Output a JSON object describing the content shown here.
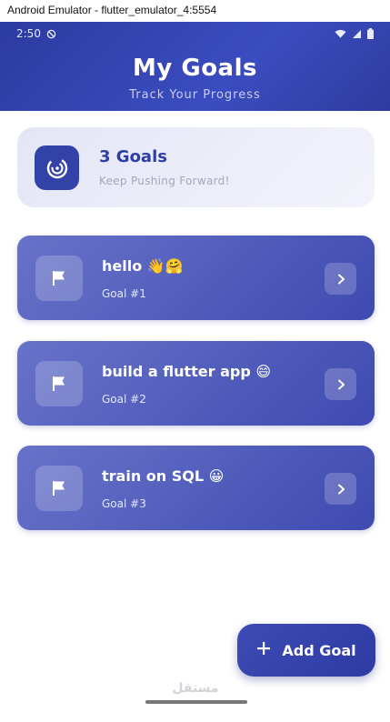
{
  "window": {
    "title": "Android Emulator - flutter_emulator_4:5554"
  },
  "status_bar": {
    "time": "2:50"
  },
  "header": {
    "title": "My Goals",
    "subtitle": "Track Your Progress"
  },
  "summary": {
    "count_label": "3 Goals",
    "tagline": "Keep Pushing Forward!"
  },
  "goals": [
    {
      "title": "hello 👋🤗",
      "number": "Goal #1"
    },
    {
      "title": "build a flutter app 😄",
      "number": "Goal #2"
    },
    {
      "title": "train on SQL 😀",
      "number": "Goal #3"
    }
  ],
  "fab": {
    "label": "Add Goal"
  },
  "watermark": {
    "text": "مستقل"
  },
  "colors": {
    "primary": "#3342a6",
    "card_start": "#6773c9",
    "card_end": "#3e4ab0"
  }
}
